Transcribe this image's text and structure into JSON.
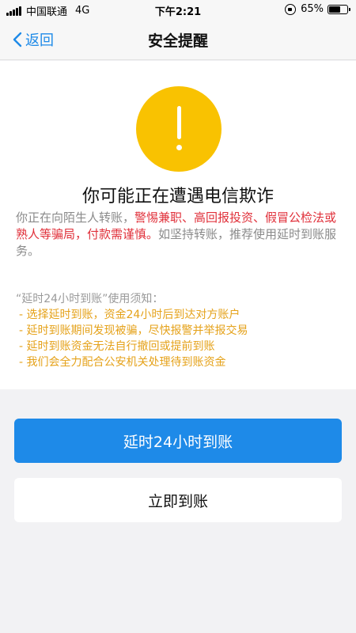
{
  "status_bar": {
    "carrier": "中国联通",
    "network": "4G",
    "time": "下午2:21",
    "battery": "65%",
    "battery_level": 0.65
  },
  "nav": {
    "back_label": "返回",
    "title": "安全提醒"
  },
  "alert": {
    "icon": "warning-icon",
    "icon_color": "#f9c201",
    "headline": "你可能正在遭遇电信欺诈",
    "desc_prefix": "你正在向陌生人转账，",
    "desc_warning": "警惕兼职、高回报投资、假冒公检法或熟人等骗局，付款需谨慎。",
    "desc_suffix": "如坚持转账，推荐使用延时到账服务。",
    "warning_color": "#e0303a"
  },
  "notice": {
    "title": "“延时24小时到账”使用须知：",
    "items": [
      "- 选择延时到账，资金24小时后到达对方账户",
      "- 延时到账期间发现被骗，尽快报警并举报交易",
      "- 延时到账资金无法自行撤回或提前到账",
      "- 我们会全力配合公安机关处理待到账资金"
    ],
    "color": "#e5a21a"
  },
  "actions": {
    "delay_label": "延时24小时到账",
    "instant_label": "立即到账",
    "accent": "#1e8ae8"
  }
}
